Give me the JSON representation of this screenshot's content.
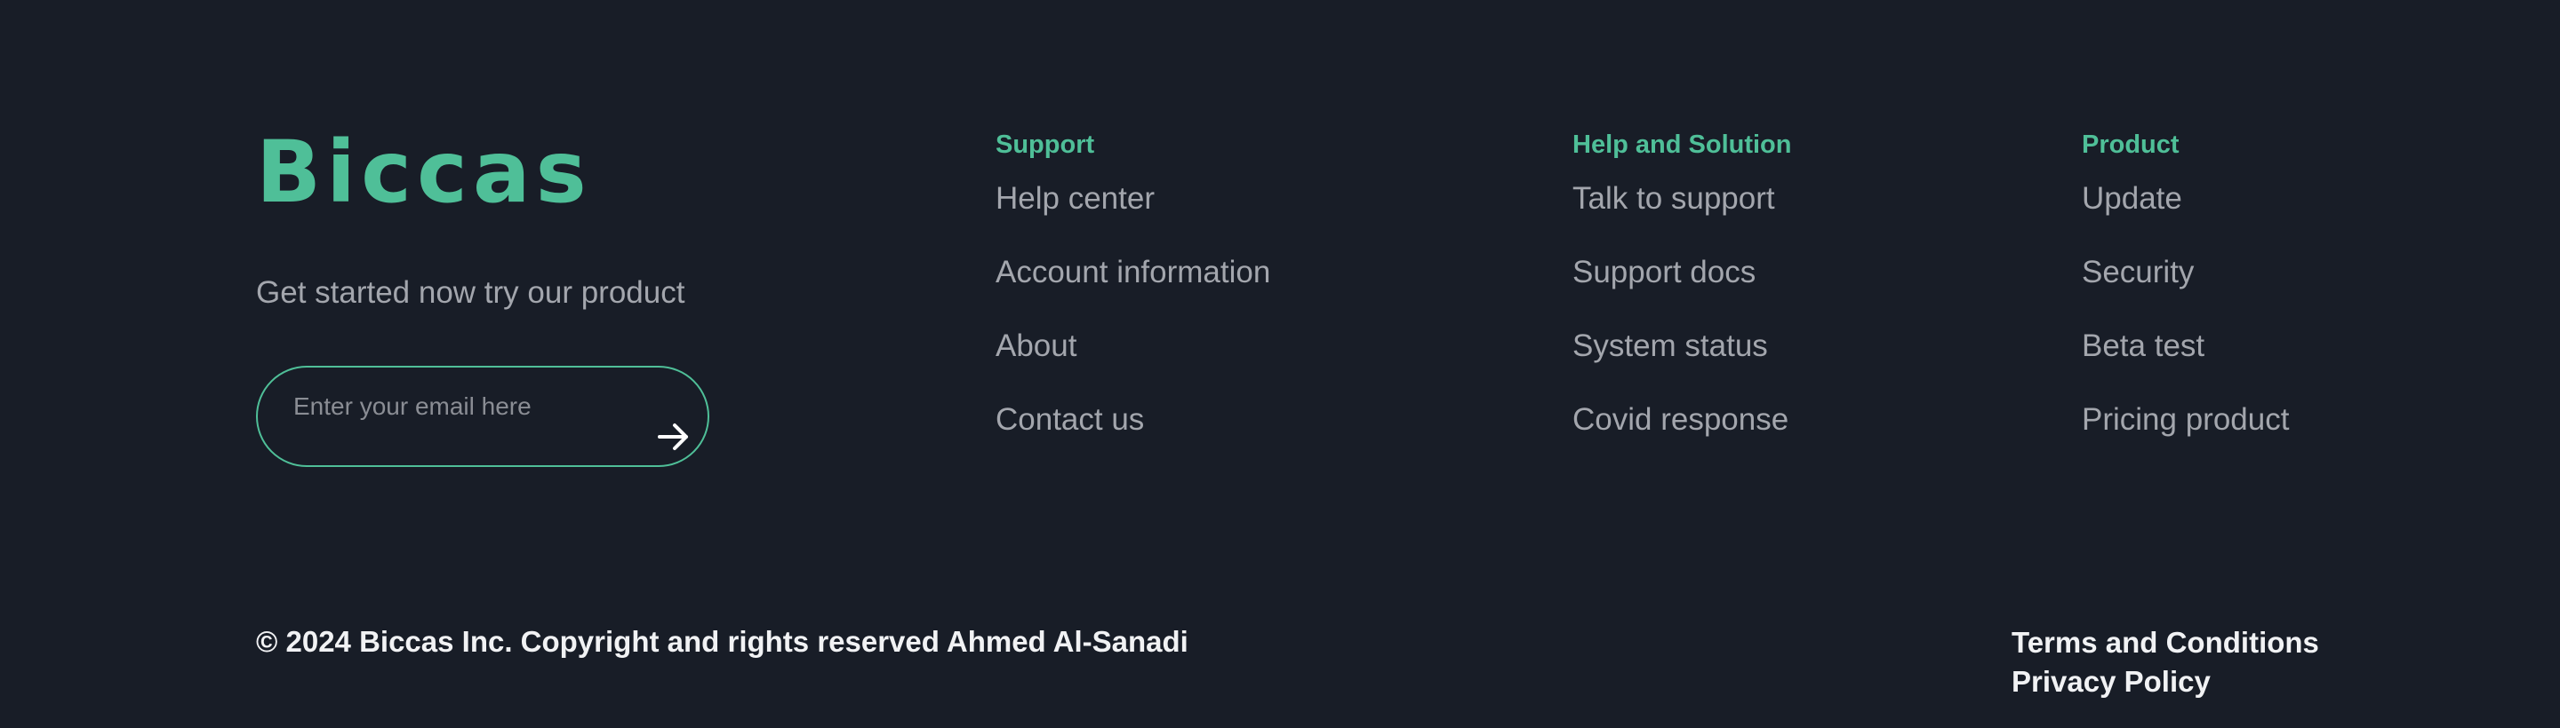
{
  "brand": {
    "logo": "Biccas",
    "tagline": "Get started now try our product",
    "accent_color": "#4fbf98"
  },
  "newsletter": {
    "placeholder": "Enter your email here",
    "value": "",
    "submit_icon": "arrow-right-icon"
  },
  "columns": [
    {
      "heading": "Support",
      "links": [
        "Help center",
        "Account information",
        "About",
        "Contact us"
      ]
    },
    {
      "heading": "Help and Solution",
      "links": [
        "Talk to support",
        "Support docs",
        "System status",
        "Covid response"
      ]
    },
    {
      "heading": "Product",
      "links": [
        "Update",
        "Security",
        "Beta test",
        "Pricing product"
      ]
    }
  ],
  "footer": {
    "copyright": "© 2024 Biccas Inc. Copyright and rights reserved Ahmed Al-Sanadi",
    "terms": "Terms and Conditions",
    "privacy": "Privacy Policy"
  }
}
